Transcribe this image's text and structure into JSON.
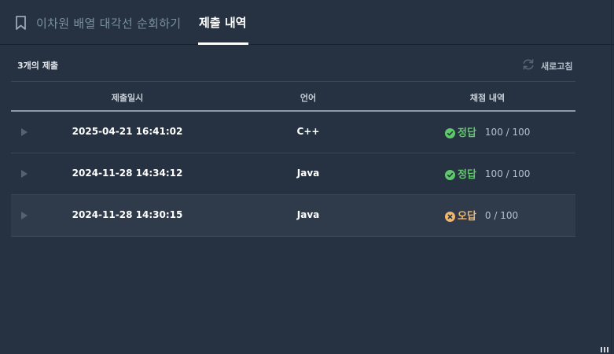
{
  "tabs": {
    "problem_title": "이차원 배열 대각선 순회하기",
    "submissions_label": "제출 내역"
  },
  "summary": {
    "count_text": "3개의 제출",
    "refresh_label": "새로고침"
  },
  "table": {
    "headers": {
      "date": "제출일시",
      "language": "언어",
      "result": "채점 내역"
    },
    "rows": [
      {
        "date": "2025-04-21 16:41:02",
        "language": "C++",
        "verdict": "정답",
        "status": "correct",
        "score": "100 / 100"
      },
      {
        "date": "2024-11-28 14:34:12",
        "language": "Java",
        "verdict": "정답",
        "status": "correct",
        "score": "100 / 100"
      },
      {
        "date": "2024-11-28 14:30:15",
        "language": "Java",
        "verdict": "오답",
        "status": "wrong",
        "score": "0 / 100"
      }
    ]
  },
  "colors": {
    "background": "#263241",
    "correct": "#5fc86b",
    "wrong": "#f2b76a",
    "active_tab_underline": "#ffffff"
  },
  "icons": [
    "bookmark-icon",
    "refresh-icon",
    "play-icon",
    "check-circle-icon",
    "x-circle-icon",
    "resize-grip-icon"
  ]
}
